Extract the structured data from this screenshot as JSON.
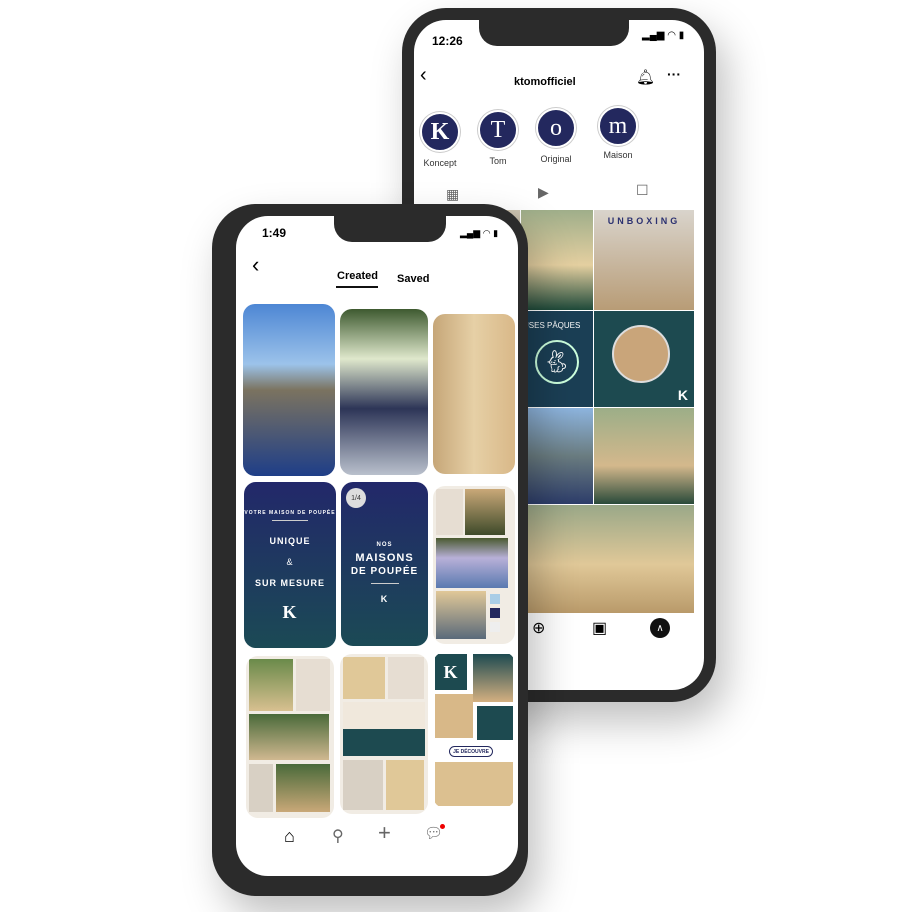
{
  "back_phone": {
    "status_time": "12:26",
    "username": "ktomofficiel",
    "highlights": [
      {
        "letter": "K",
        "label": "Koncept"
      },
      {
        "letter": "T",
        "label": "Tom"
      },
      {
        "letter": "o",
        "label": "Original"
      },
      {
        "letter": "m",
        "label": "Maison"
      }
    ],
    "tabs": [
      "grid-icon",
      "reels-icon",
      "tagged-icon"
    ],
    "posts": {
      "unboxing": "UNBOXING",
      "easter": "USES PÂQUES",
      "logo": "K"
    },
    "nav": [
      "add-icon",
      "reels-icon",
      "profile-icon"
    ]
  },
  "front_phone": {
    "status_time": "1:49",
    "tabs": {
      "created": "Created",
      "saved": "Saved"
    },
    "pins": {
      "votre": "VOTRE MAISON DE POUPÉE",
      "unique": "UNIQUE",
      "amp": "&",
      "sur_mesure": "SUR MESURE",
      "page_badge": "1/4",
      "nos": "NOS",
      "maisons": "MAISONS",
      "de_poupee": "DE POUPÉE",
      "logo": "K",
      "decouvre": "JE DÉCOUVRE"
    },
    "nav": [
      "home-icon",
      "search-icon",
      "plus-icon",
      "chat-icon"
    ]
  },
  "colors": {
    "navy": "#23285e",
    "teal": "#1b4a55",
    "phone": "#2b2b2b"
  }
}
